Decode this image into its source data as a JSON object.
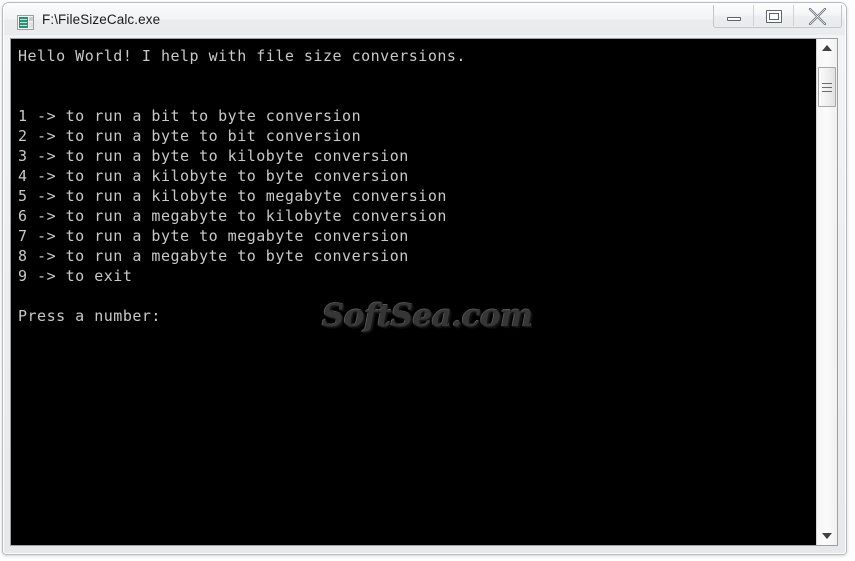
{
  "window": {
    "title": "F:\\FileSizeCalc.exe",
    "icon_name": "console-app-icon",
    "controls": {
      "minimize_label": "Minimize",
      "maximize_label": "Restore",
      "close_label": "Close"
    }
  },
  "console": {
    "background_color": "#000000",
    "text_color": "#c9c9c9",
    "lines": [
      "Hello World! I help with file size conversions.",
      "",
      "",
      "1 -> to run a bit to byte conversion",
      "2 -> to run a byte to bit conversion",
      "3 -> to run a byte to kilobyte conversion",
      "4 -> to run a kilobyte to byte conversion",
      "5 -> to run a kilobyte to megabyte conversion",
      "6 -> to run a megabyte to kilobyte conversion",
      "7 -> to run a byte to megabyte conversion",
      "8 -> to run a megabyte to byte conversion",
      "9 -> to exit",
      "",
      "Press a number:"
    ],
    "text": "Hello World! I help with file size conversions.\n\n\n1 -> to run a bit to byte conversion\n2 -> to run a byte to bit conversion\n3 -> to run a byte to kilobyte conversion\n4 -> to run a kilobyte to byte conversion\n5 -> to run a kilobyte to megabyte conversion\n6 -> to run a megabyte to kilobyte conversion\n7 -> to run a byte to megabyte conversion\n8 -> to run a megabyte to byte conversion\n9 -> to exit\n\nPress a number:"
  },
  "watermark": {
    "text": "SoftSea.com"
  },
  "scrollbar": {
    "up_arrow_name": "scroll-up-arrow",
    "down_arrow_name": "scroll-down-arrow"
  }
}
